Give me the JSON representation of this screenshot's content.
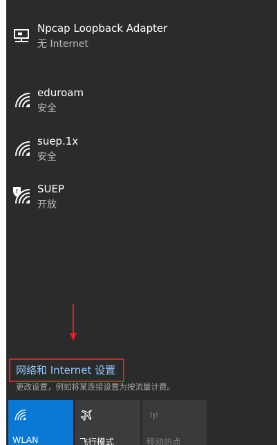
{
  "networks": [
    {
      "name": "Npcap Loopback Adapter",
      "status": "无 Internet",
      "icon": "ethernet-icon"
    },
    {
      "name": "eduroam",
      "status": "安全",
      "icon": "wifi-icon"
    },
    {
      "name": "suep.1x",
      "status": "安全",
      "icon": "wifi-icon"
    },
    {
      "name": "SUEP",
      "status": "开放",
      "icon": "wifi-open-icon"
    }
  ],
  "settings": {
    "link": "网络和 Internet 设置",
    "description": "更改设置，例如将某连接设置为按流量计费。"
  },
  "tiles": [
    {
      "label": "WLAN",
      "icon": "wifi-icon",
      "state": "on"
    },
    {
      "label": "飞行模式",
      "icon": "airplane-icon",
      "state": "off"
    },
    {
      "label": "移动热点",
      "icon": "hotspot-icon",
      "state": "disabled"
    }
  ],
  "colors": {
    "background": "#2b2b2b",
    "accent": "#0a78d4",
    "link": "#8fc7ff",
    "highlight_box": "#e01e24"
  }
}
